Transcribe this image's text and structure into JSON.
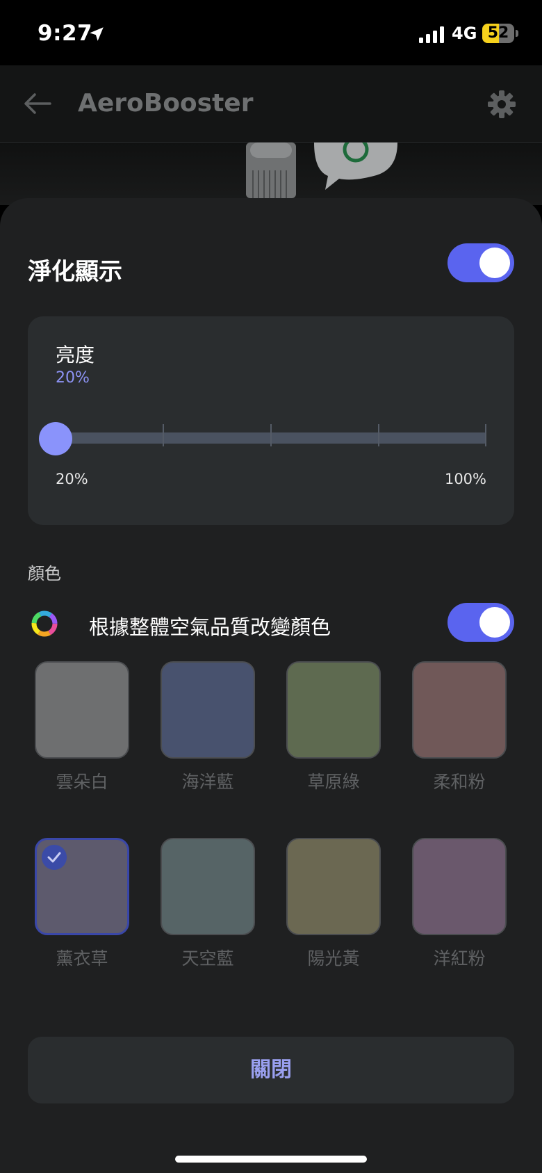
{
  "status": {
    "time": "9:27",
    "network": "4G",
    "battery": "52",
    "battery_level": 0.52
  },
  "header": {
    "title": "AeroBooster"
  },
  "sheet": {
    "title": "淨化顯示",
    "display_toggle_on": true,
    "brightness": {
      "label": "亮度",
      "value": "20%",
      "level": 0.2,
      "min_label": "20%",
      "max_label": "100%"
    },
    "color": {
      "section_label": "顏色",
      "auto_label": "根據整體空氣品質改變顏色",
      "auto_toggle_on": true,
      "swatches": [
        {
          "label": "雲朵白",
          "color": "#6e6f70",
          "selected": false
        },
        {
          "label": "海洋藍",
          "color": "#48526e",
          "selected": false
        },
        {
          "label": "草原綠",
          "color": "#5e6a50",
          "selected": false
        },
        {
          "label": "柔和粉",
          "color": "#705858",
          "selected": false
        },
        {
          "label": "薰衣草",
          "color": "#5d5a6d",
          "selected": true
        },
        {
          "label": "天空藍",
          "color": "#566466",
          "selected": false
        },
        {
          "label": "陽光黃",
          "color": "#6b6852",
          "selected": false
        },
        {
          "label": "洋紅粉",
          "color": "#6a586c",
          "selected": false
        }
      ]
    },
    "close_label": "關閉"
  },
  "colors": {
    "accent": "#5a64ef",
    "thumb": "#8a93fb",
    "sheet_bg": "#1f2021",
    "card_bg": "#2a2d2f"
  }
}
